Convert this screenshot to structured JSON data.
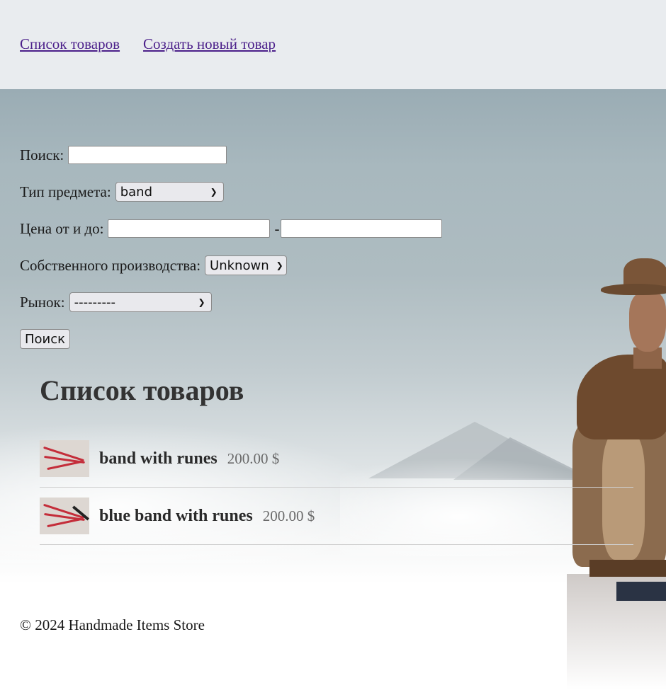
{
  "nav": {
    "links": [
      {
        "label": "Список товаров"
      },
      {
        "label": "Создать новый товар"
      }
    ]
  },
  "search_form": {
    "query_label": "Поиск:",
    "query_value": "",
    "type_label": "Тип предмета:",
    "type_selected": "band",
    "price_label": "Цена от и до:",
    "price_from": "",
    "price_separator": "-",
    "price_to": "",
    "own_production_label": "Собственного производства:",
    "own_production_selected": "Unknown",
    "market_label": "Рынок:",
    "market_selected": "---------",
    "submit_label": "Поиск"
  },
  "product_list": {
    "title": "Список товаров",
    "items": [
      {
        "name": "band with runes",
        "price": "200.00 $"
      },
      {
        "name": "blue band with runes",
        "price": "200.00 $"
      }
    ]
  },
  "footer": {
    "text": "© 2024 Handmade Items Store"
  },
  "colors": {
    "header_bg": "#e9ecef",
    "link": "#4b1f8a",
    "sky": "#a8b8be"
  }
}
